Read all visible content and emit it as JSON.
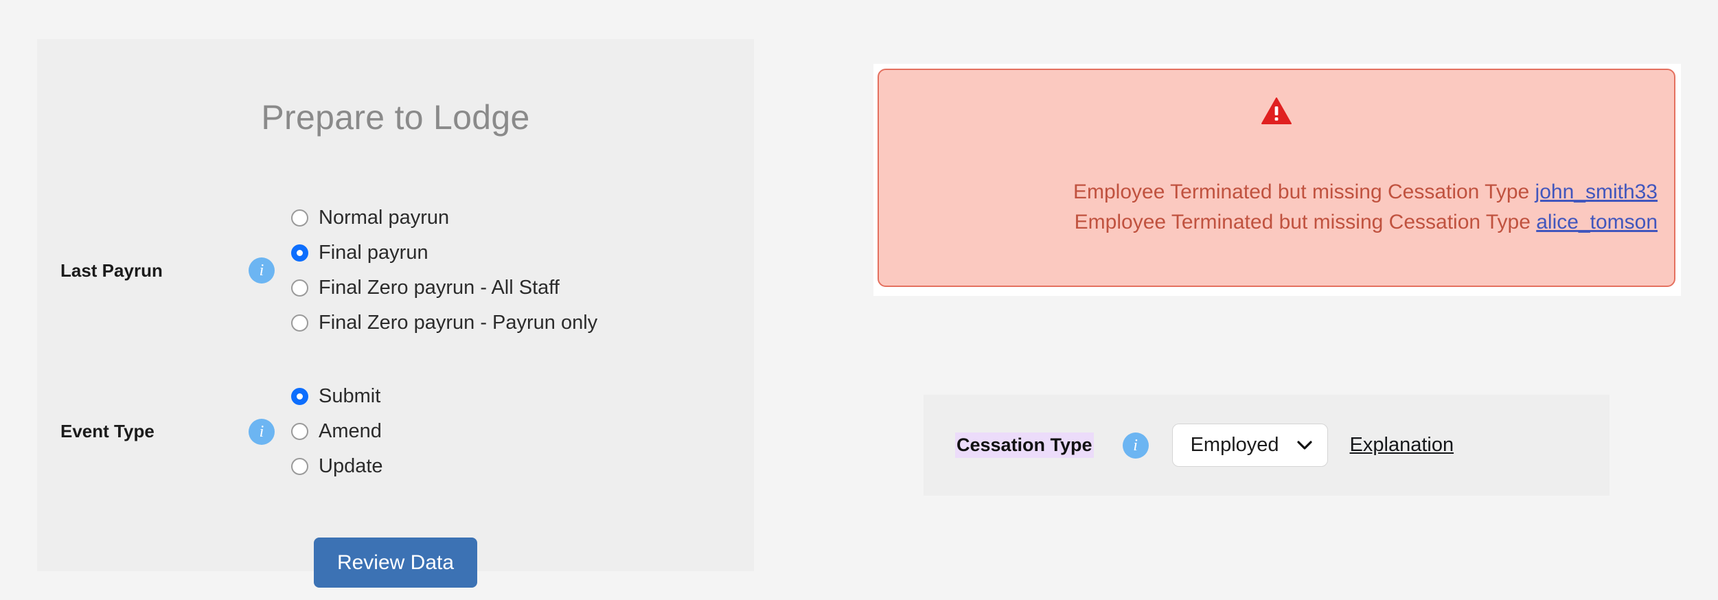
{
  "colors": {
    "page_bg": "#f4f4f4",
    "panel_bg": "#eeeeee",
    "accent_button": "#3c72b4",
    "info_icon": "#6cb5f2",
    "radio_checked": "#0d6efd",
    "alert_bg": "#fbc9c0",
    "alert_border": "#e4705f",
    "alert_text": "#c0523f",
    "alert_link": "#4156bd",
    "warning_icon": "#e02020",
    "highlight": "#ecdcfa"
  },
  "left_panel": {
    "title": "Prepare to Lodge",
    "rows": [
      {
        "label": "Last Payrun",
        "info_icon": "info-icon",
        "options": [
          {
            "label": "Normal payrun",
            "checked": false
          },
          {
            "label": "Final payrun",
            "checked": true
          },
          {
            "label": "Final Zero payrun - All Staff",
            "checked": false
          },
          {
            "label": "Final Zero payrun - Payrun only",
            "checked": false
          }
        ]
      },
      {
        "label": "Event Type",
        "info_icon": "info-icon",
        "options": [
          {
            "label": "Submit",
            "checked": true
          },
          {
            "label": "Amend",
            "checked": false
          },
          {
            "label": "Update",
            "checked": false
          }
        ]
      }
    ],
    "submit_button": "Review Data"
  },
  "alert": {
    "icon": "warning-triangle-icon",
    "messages": [
      {
        "text": "Employee Terminated but missing Cessation Type",
        "link": "john_smith33"
      },
      {
        "text": "Employee Terminated but missing Cessation Type",
        "link": "alice_tomson"
      }
    ]
  },
  "cessation": {
    "label": "Cessation Type",
    "info_icon": "info-icon",
    "select_value": "Employed",
    "select_chevron": "chevron-down-icon",
    "explanation_link": "Explanation"
  }
}
